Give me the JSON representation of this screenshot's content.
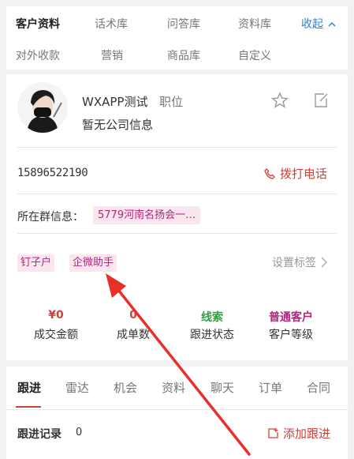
{
  "top_nav": {
    "row1": [
      "客户资料",
      "话术库",
      "问答库",
      "资料库"
    ],
    "collapse_label": "收起",
    "row2": [
      "对外收款",
      "营销",
      "商品库",
      "自定义"
    ]
  },
  "customer": {
    "name": "WXAPP测试",
    "position": "职位",
    "company": "暂无公司信息",
    "phone": "15896522190",
    "dial_label": "拨打电话",
    "group_label": "所在群信息：",
    "group_value": "5779河南名扬会一…",
    "tags": [
      "钉子户",
      "企微助手"
    ],
    "set_tags_label": "设置标签"
  },
  "stats": [
    {
      "value": "¥0",
      "label": "成交金额",
      "color": "#d0403a"
    },
    {
      "value": "0",
      "label": "成单数",
      "color": "#d0403a"
    },
    {
      "value": "线索",
      "label": "跟进状态",
      "color": "#2e9e3e"
    },
    {
      "value": "普通客户",
      "label": "客户等级",
      "color": "#b0247d"
    }
  ],
  "tabs": [
    "跟进",
    "雷达",
    "机会",
    "资料",
    "聊天",
    "订单",
    "合同"
  ],
  "records": {
    "label": "跟进记录",
    "count": "0",
    "add_label": "添加跟进"
  },
  "colors": {
    "accent_red": "#d0403a",
    "tag_magenta": "#b0247d",
    "link_blue": "#2b7cd8",
    "annotation_arrow": "#e8302a"
  }
}
